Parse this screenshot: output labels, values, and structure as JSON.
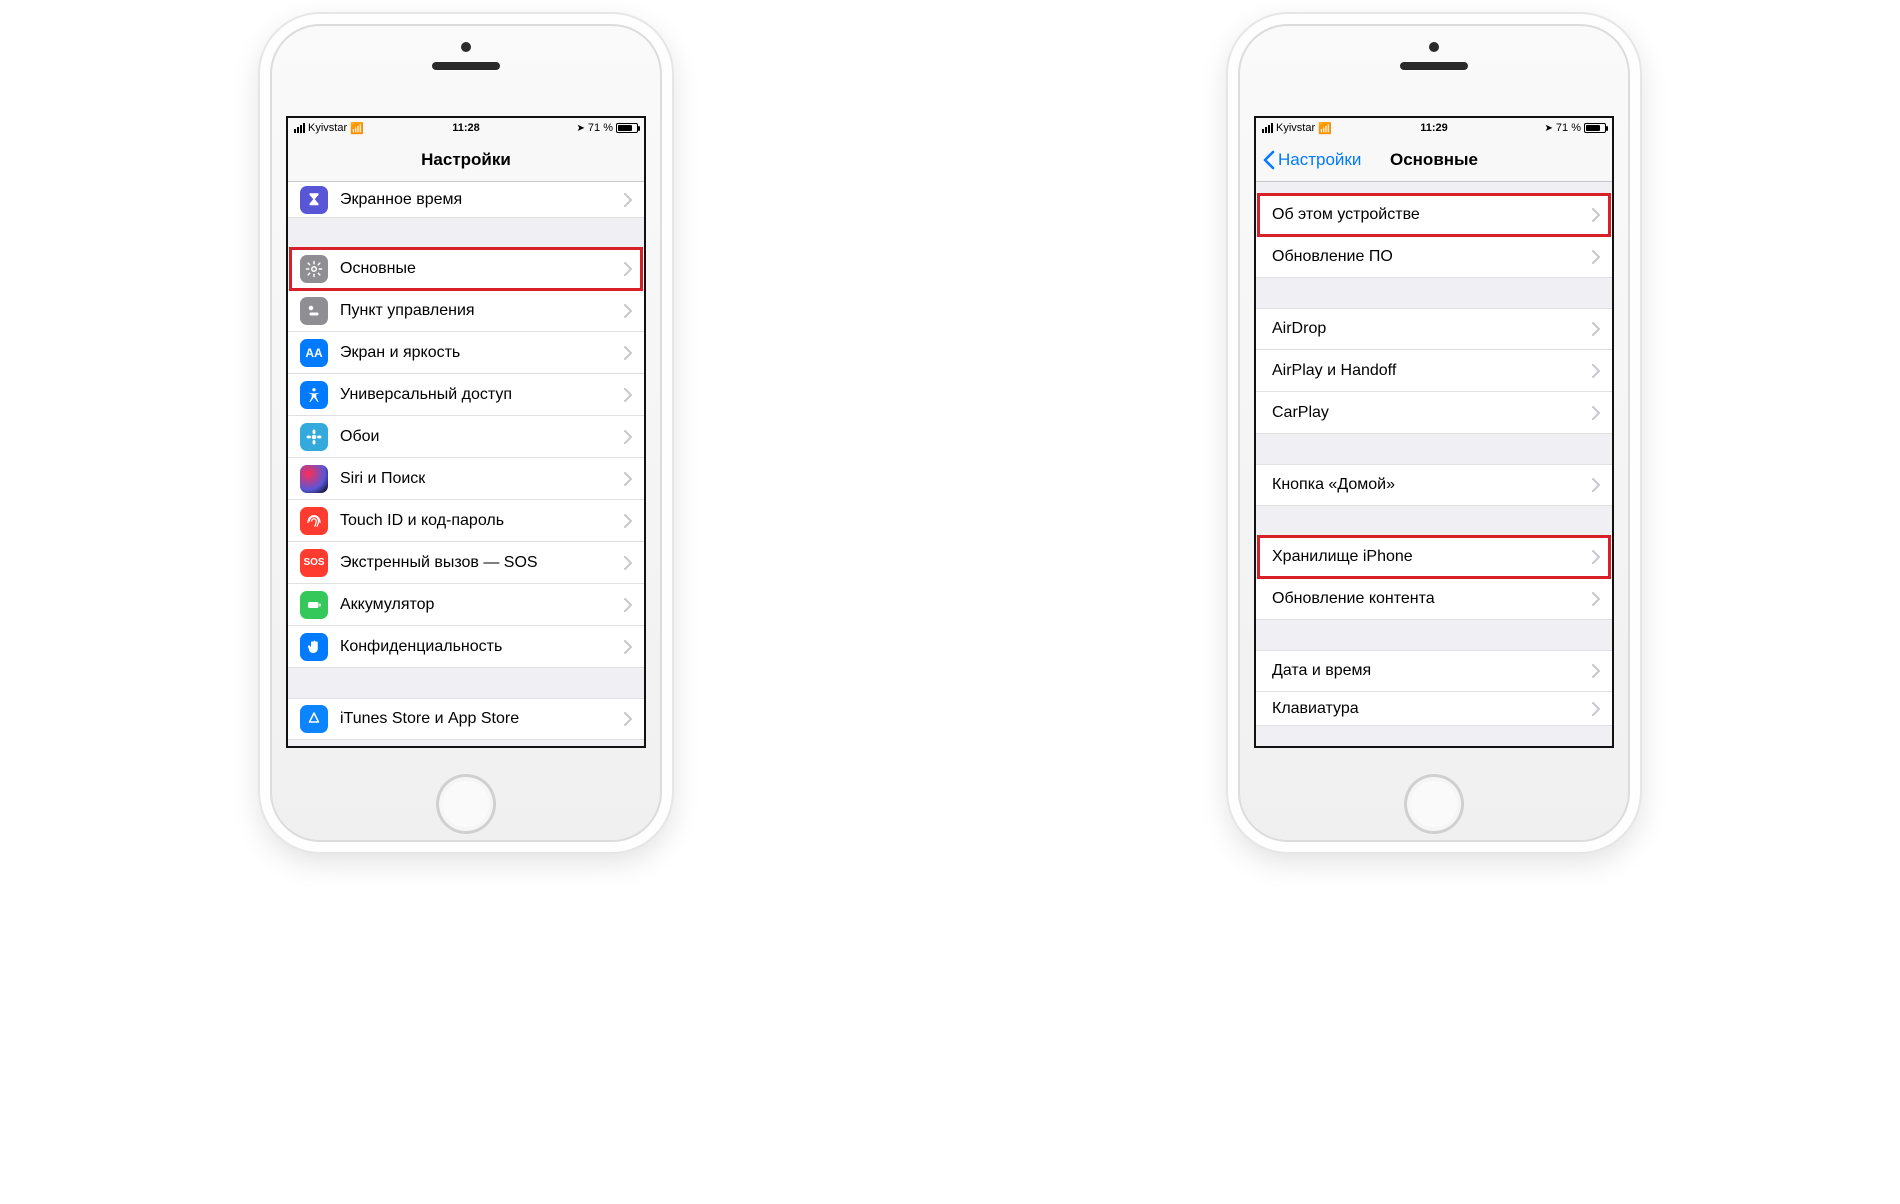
{
  "phone1": {
    "status": {
      "carrier": "Kyivstar",
      "time": "11:28",
      "battery_pct": "71 %"
    },
    "nav": {
      "title": "Настройки"
    },
    "rows": {
      "screentime": "Экранное время",
      "general": "Основные",
      "controlcenter": "Пункт управления",
      "display": "Экран и яркость",
      "accessibility": "Универсальный доступ",
      "wallpaper": "Обои",
      "siri": "Siri и Поиск",
      "touchid": "Touch ID и код-пароль",
      "sos": "Экстренный вызов — SOS",
      "battery": "Аккумулятор",
      "privacy": "Конфиденциальность",
      "appstore": "iTunes Store и App Store"
    },
    "sos_label": "SOS"
  },
  "phone2": {
    "status": {
      "carrier": "Kyivstar",
      "time": "11:29",
      "battery_pct": "71 %"
    },
    "nav": {
      "back": "Настройки",
      "title": "Основные"
    },
    "rows": {
      "about": "Об этом устройстве",
      "update": "Обновление ПО",
      "airdrop": "AirDrop",
      "airplay": "AirPlay и Handoff",
      "carplay": "CarPlay",
      "home": "Кнопка «Домой»",
      "storage": "Хранилище iPhone",
      "refresh": "Обновление контента",
      "datetime": "Дата и время",
      "keyboard": "Клавиатура"
    }
  }
}
